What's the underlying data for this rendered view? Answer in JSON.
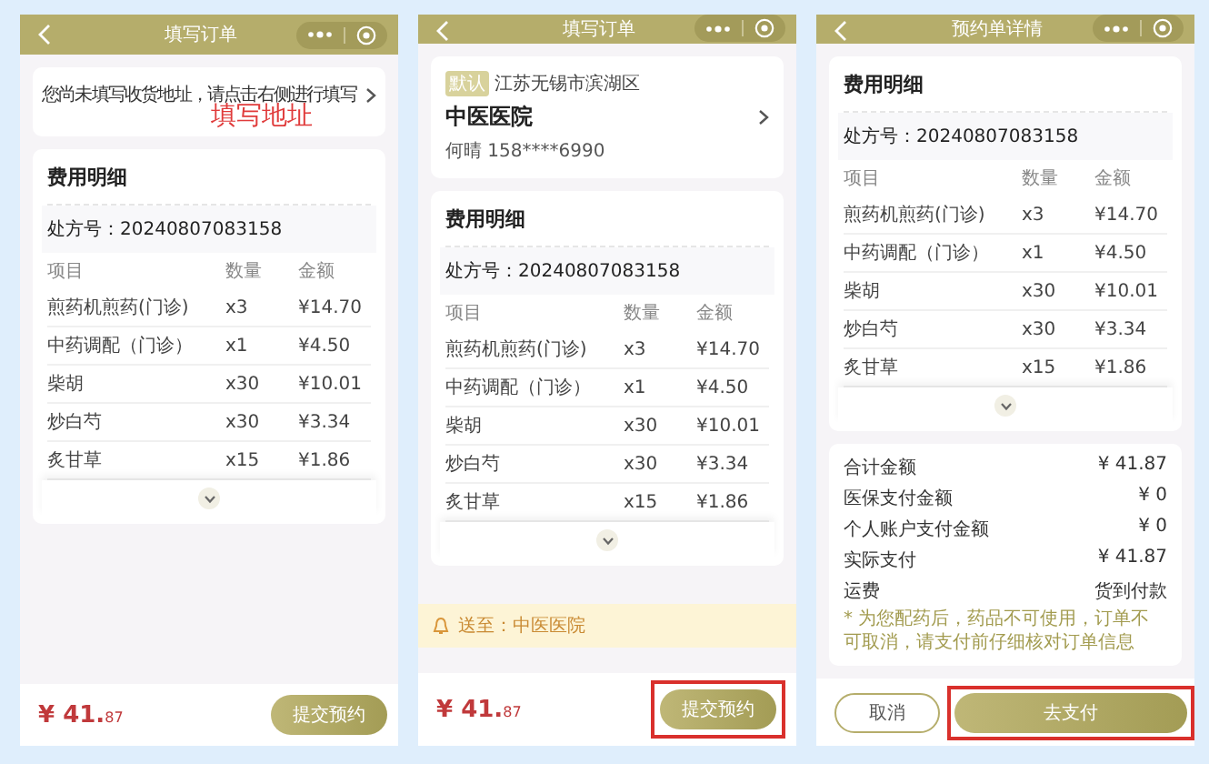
{
  "panels": [
    {
      "sections": [
        {
          "kind": "header",
          "title": "填写订单"
        },
        {
          "kind": "address_empty",
          "text": "您尚未填写收货地址，请点击右侧进行填写",
          "annotation": "填写地址"
        },
        {
          "kind": "fees",
          "title": "费用明细",
          "prescription": "处方号：20240807083158",
          "columns": [
            "项目",
            "数量",
            "金额"
          ],
          "rows": [
            [
              "煎药机煎药(门诊)",
              "x3",
              "¥14.70"
            ],
            [
              "中药调配（门诊）",
              "x1",
              "¥4.50"
            ],
            [
              "柴胡",
              "x30",
              "¥10.01"
            ],
            [
              "炒白芍",
              "x30",
              "¥3.34"
            ],
            [
              "炙甘草",
              "x15",
              "¥1.86"
            ]
          ]
        },
        {
          "kind": "footer",
          "price": "¥ 41.",
          "cents": "87",
          "buttons": [
            {
              "label": "提交预约",
              "kind": "primary",
              "highlighted": false
            }
          ]
        }
      ]
    },
    {
      "sections": [
        {
          "kind": "header",
          "title": "填写订单"
        },
        {
          "kind": "address",
          "tag": "默认",
          "region": "江苏无锡市滨湖区",
          "name": "中医医院",
          "contact": "何晴 158****6990"
        },
        {
          "kind": "fees",
          "title": "费用明细",
          "prescription": "处方号：20240807083158",
          "columns": [
            "项目",
            "数量",
            "金额"
          ],
          "rows": [
            [
              "煎药机煎药(门诊)",
              "x3",
              "¥14.70"
            ],
            [
              "中药调配（门诊）",
              "x1",
              "¥4.50"
            ],
            [
              "柴胡",
              "x30",
              "¥10.01"
            ],
            [
              "炒白芍",
              "x30",
              "¥3.34"
            ],
            [
              "炙甘草",
              "x15",
              "¥1.86"
            ]
          ]
        },
        {
          "kind": "notice",
          "text": "送至：中医医院"
        },
        {
          "kind": "footer",
          "price": "¥ 41.",
          "cents": "87",
          "buttons": [
            {
              "label": "提交预约",
              "kind": "primary",
              "highlighted": true
            }
          ]
        }
      ]
    },
    {
      "sections": [
        {
          "kind": "header",
          "title": "预约单详情"
        },
        {
          "kind": "fees",
          "title": "费用明细",
          "prescription": "处方号：20240807083158",
          "columns": [
            "项目",
            "数量",
            "金额"
          ],
          "rows": [
            [
              "煎药机煎药(门诊)",
              "x3",
              "¥14.70"
            ],
            [
              "中药调配（门诊）",
              "x1",
              "¥4.50"
            ],
            [
              "柴胡",
              "x30",
              "¥10.01"
            ],
            [
              "炒白芍",
              "x30",
              "¥3.34"
            ],
            [
              "炙甘草",
              "x15",
              "¥1.86"
            ]
          ]
        },
        {
          "kind": "summary",
          "rows": [
            {
              "label": "合计金额",
              "value": "¥ 41.87"
            },
            {
              "label": "医保支付金额",
              "value": "¥ 0"
            },
            {
              "label": "个人账户支付金额",
              "value": "¥ 0"
            },
            {
              "label": "实际支付",
              "value": "¥ 41.87"
            },
            {
              "label": "运费",
              "value": "货到付款"
            }
          ],
          "note": "* 为您配药后，药品不可使用，订单不可取消，请支付前仔细核对订单信息"
        },
        {
          "kind": "footer",
          "buttons": [
            {
              "label": "取消",
              "kind": "outline",
              "highlighted": false
            },
            {
              "label": "去支付",
              "kind": "wide",
              "highlighted": true
            }
          ]
        }
      ]
    }
  ]
}
